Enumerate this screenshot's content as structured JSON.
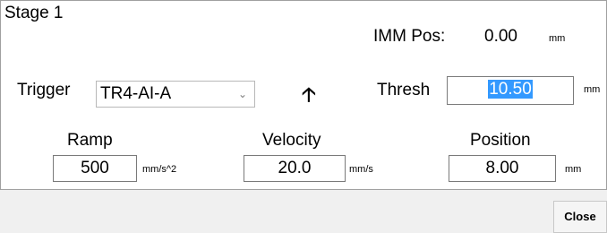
{
  "stage": {
    "title": "Stage 1"
  },
  "imm_pos": {
    "label": "IMM Pos:",
    "value": "0.00",
    "unit": "mm"
  },
  "trigger": {
    "label": "Trigger",
    "selected": "TR4-AI-A",
    "direction_icon": "arrow-up-icon"
  },
  "thresh": {
    "label": "Thresh",
    "value": "10.50",
    "unit": "mm"
  },
  "ramp": {
    "label": "Ramp",
    "value": "500",
    "unit": "mm/s^2"
  },
  "velocity": {
    "label": "Velocity",
    "value": "20.0",
    "unit": "mm/s"
  },
  "position": {
    "label": "Position",
    "value": "8.00",
    "unit": "mm"
  },
  "buttons": {
    "close_label": "Close"
  },
  "colors": {
    "selection": "#3399ff",
    "panel": "#ffffff",
    "background": "#f0f0f0"
  }
}
